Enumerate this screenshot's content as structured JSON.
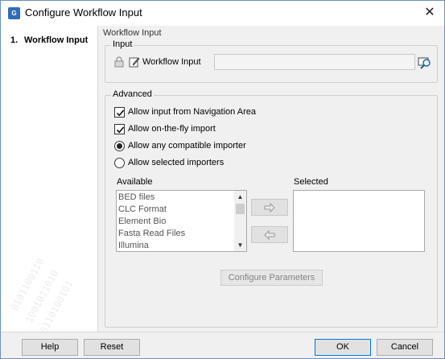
{
  "window": {
    "title": "Configure Workflow Input",
    "app_icon_text": "G",
    "close_glyph": "✕"
  },
  "sidebar": {
    "items": [
      {
        "number": "1.",
        "label": "Workflow Input"
      }
    ]
  },
  "main": {
    "section_title": "Workflow Input",
    "input_group": {
      "title": "Input",
      "field_label": "Workflow Input",
      "field_value": "",
      "icons": [
        "lock-icon",
        "edit-icon",
        "browse-icon"
      ]
    },
    "advanced_group": {
      "title": "Advanced",
      "options": [
        {
          "type": "checkbox",
          "label": "Allow input from Navigation Area",
          "checked": true
        },
        {
          "type": "checkbox",
          "label": "Allow on-the-fly import",
          "checked": true
        },
        {
          "type": "radio",
          "label": "Allow any compatible importer",
          "selected": true
        },
        {
          "type": "radio",
          "label": "Allow selected importers",
          "selected": false
        }
      ],
      "available_label": "Available",
      "selected_label": "Selected",
      "available_items": [
        "BED files",
        "CLC Format",
        "Element Bio",
        "Fasta Read Files",
        "Illumina"
      ],
      "selected_items": [],
      "configure_button": "Configure Parameters"
    }
  },
  "footer": {
    "help": "Help",
    "reset": "Reset",
    "ok": "OK",
    "cancel": "Cancel"
  },
  "watermark_text": [
    "0101100110",
    "1001011010",
    "0110100101"
  ]
}
